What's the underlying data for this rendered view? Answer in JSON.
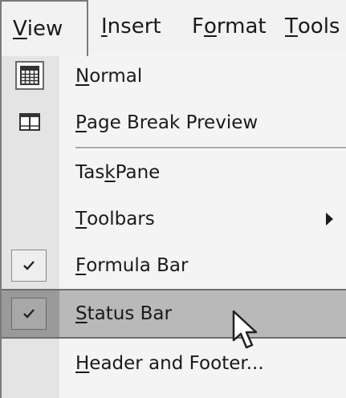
{
  "menubar": {
    "items": [
      {
        "label": "View",
        "mnemonic": "V",
        "rest": "iew"
      },
      {
        "label": "Insert",
        "mnemonic": "I",
        "rest": "nsert"
      },
      {
        "label": "Format",
        "before": "F",
        "mnemonic": "o",
        "rest": "rmat"
      },
      {
        "label": "Tools",
        "mnemonic": "T",
        "rest": "ools"
      }
    ]
  },
  "menu": {
    "items": [
      {
        "label": "Normal",
        "before": "",
        "mnemonic": "N",
        "rest": "ormal",
        "icon": "normal-grid-icon"
      },
      {
        "label": "Page Break Preview",
        "before": "",
        "mnemonic": "P",
        "rest": "age Break Preview",
        "icon": "page-break-preview-icon"
      },
      {
        "label": "Task Pane",
        "before": "Tas",
        "mnemonic": "k",
        "rest": " Pane"
      },
      {
        "label": "Toolbars",
        "before": "",
        "mnemonic": "T",
        "rest": "oolbars",
        "icon": "submenu-arrow-icon"
      },
      {
        "label": "Formula Bar",
        "before": "",
        "mnemonic": "F",
        "rest": "ormula Bar",
        "checked": true,
        "icon": "checkmark-icon"
      },
      {
        "label": "Status Bar",
        "before": "",
        "mnemonic": "S",
        "rest": "tatus Bar",
        "checked": true,
        "icon": "checkmark-icon"
      },
      {
        "label": "Header and Footer...",
        "before": "",
        "mnemonic": "H",
        "rest": "eader and Footer..."
      }
    ]
  },
  "colors": {
    "menu_bg": "#f4f4f4",
    "gutter": "#e4e4e4",
    "highlight": "#b9b9b9"
  }
}
